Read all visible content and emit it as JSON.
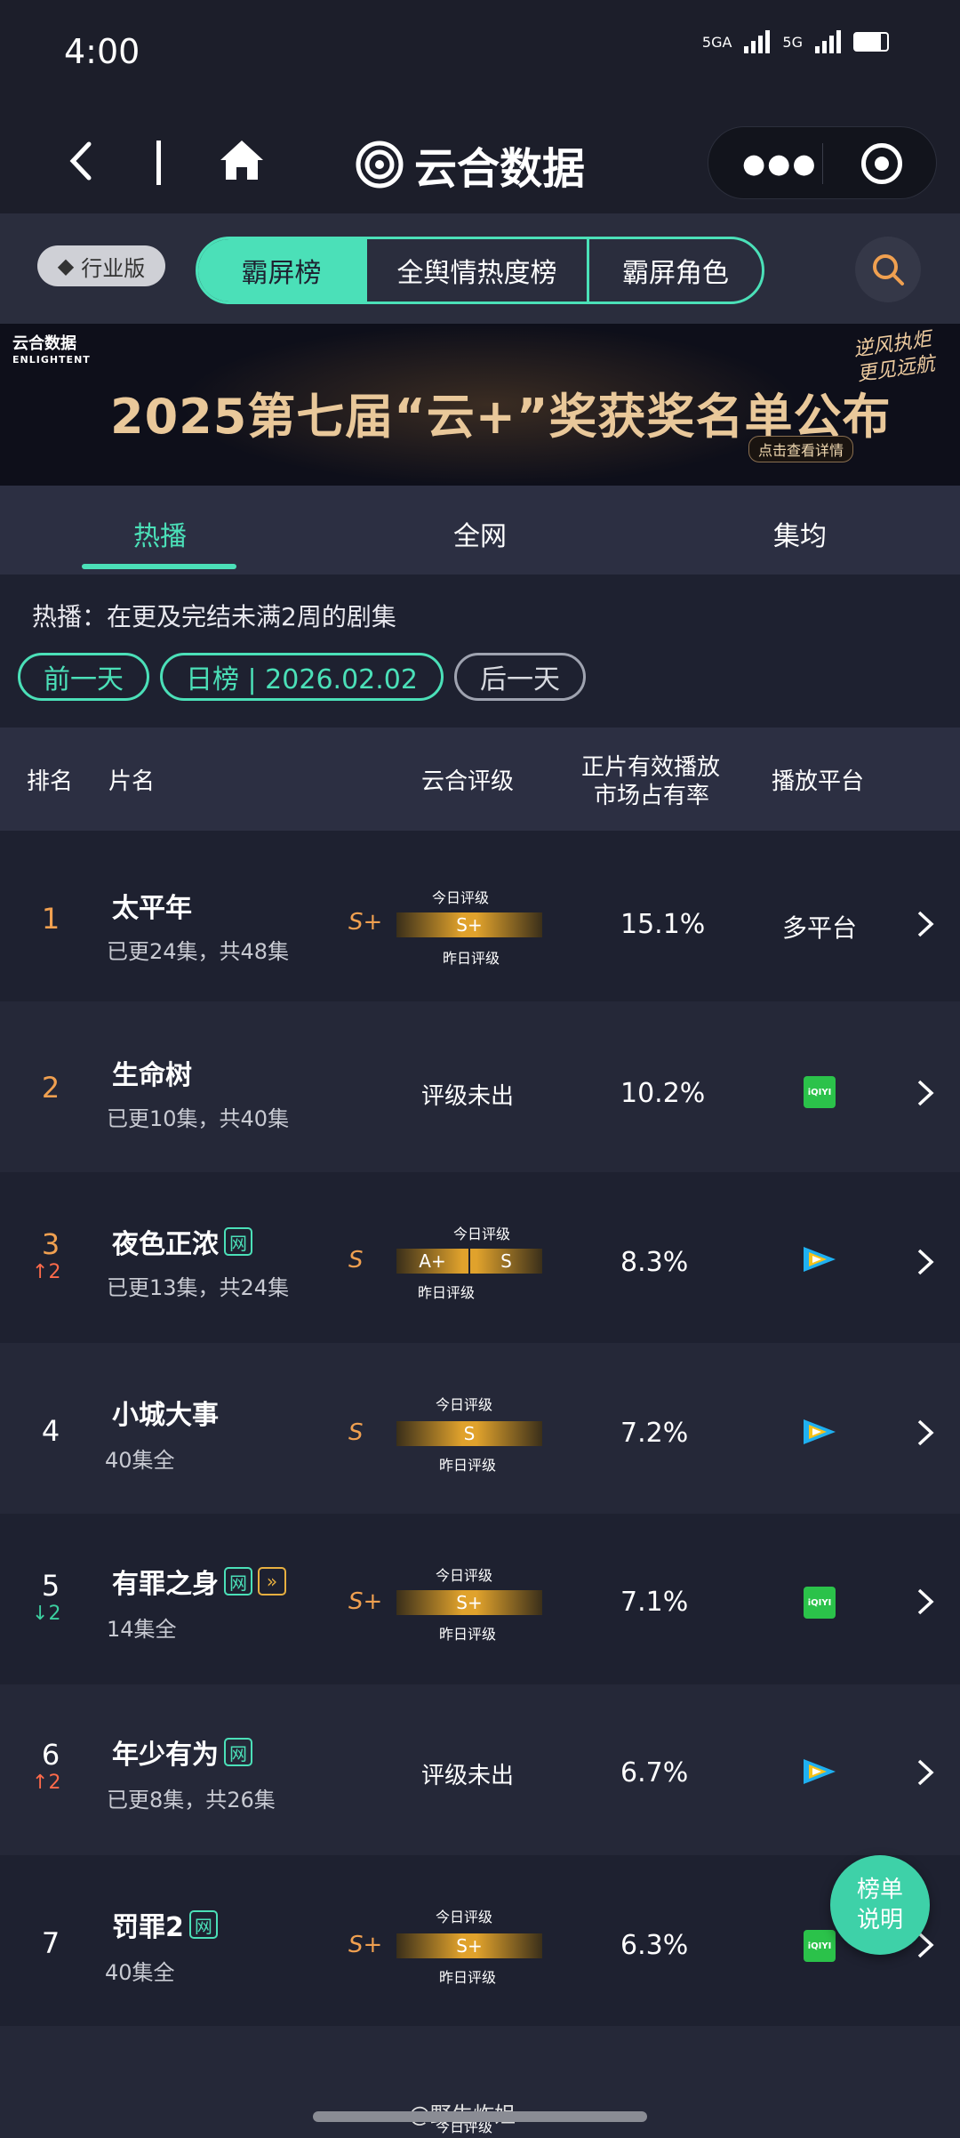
{
  "status": {
    "time": "4:00",
    "network1": "5GA",
    "network2": "5G"
  },
  "nav": {
    "brand": "云合数据"
  },
  "tabs": {
    "industry": "行业版",
    "segments": [
      "霸屏榜",
      "全舆情热度榜",
      "霸屏角色"
    ],
    "active": 0
  },
  "banner": {
    "logo": "云合数据",
    "logo_en": "ENLIGHTENT",
    "title": "2025第七届“云+”奖获奖名单公布",
    "slogan1": "逆风执炬",
    "slogan2": "更见远航",
    "detail": "点击查看详情"
  },
  "subtabs": [
    "热播",
    "全网",
    "集均"
  ],
  "desc": "热播：在更及完结未满2周的剧集",
  "pills": {
    "prev": "前一天",
    "date": "日榜 | 2026.02.02",
    "next": "后一天"
  },
  "table_header": {
    "rank": "排名",
    "title": "片名",
    "rating": "云合评级",
    "share1": "正片有效播放",
    "share2": "市场占有率",
    "platform": "播放平台"
  },
  "rating_labels": {
    "today": "今日评级",
    "yesterday": "昨日评级",
    "none": "评级未出"
  },
  "rows": [
    {
      "rank": "1",
      "title": "太平年",
      "eps": "已更24集，共48集",
      "grade": "S+",
      "meter": "S+",
      "share": "15.1%",
      "platform": "多平台"
    },
    {
      "rank": "2",
      "title": "生命树",
      "eps": "已更10集，共40集",
      "share": "10.2%",
      "platform": "iqiyi"
    },
    {
      "rank": "3",
      "trend": "2",
      "title": "夜色正浓",
      "tag": "网",
      "eps": "已更13集，共24集",
      "grade": "S",
      "meter_a": "A+",
      "meter_b": "S",
      "share": "8.3%",
      "platform": "tencent"
    },
    {
      "rank": "4",
      "title": "小城大事",
      "eps": "40集全",
      "grade": "S",
      "meter": "S",
      "share": "7.2%",
      "platform": "tencent"
    },
    {
      "rank": "5",
      "trend": "2",
      "title": "有罪之身",
      "tag": "网",
      "eps": "14集全",
      "grade": "S+",
      "meter": "S+",
      "share": "7.1%",
      "platform": "iqiyi"
    },
    {
      "rank": "6",
      "trend": "2",
      "title": "年少有为",
      "tag": "网",
      "eps": "已更8集，共26集",
      "share": "6.7%",
      "platform": "tencent"
    },
    {
      "rank": "7",
      "title": "罚罪2",
      "tag": "网",
      "eps": "40集全",
      "grade": "S+",
      "meter": "S+",
      "share": "6.3%",
      "platform": "iqiyi"
    }
  ],
  "help": {
    "line1": "榜单",
    "line2": "说明"
  },
  "watermark": "@野生炸姐",
  "icons": [
    "back-icon",
    "home-icon",
    "brand-logo-icon",
    "more-icon",
    "target-icon",
    "diamond-icon",
    "search-icon",
    "chevron-right-icon",
    "arrow-up-icon",
    "arrow-down-icon",
    "iqiyi-icon",
    "tencent-video-icon"
  ],
  "colors": {
    "accent": "#4be0b8",
    "grade": "#f0a050",
    "up": "#ff6a4a",
    "down": "#3cd0a0",
    "background": "#1e2130"
  }
}
